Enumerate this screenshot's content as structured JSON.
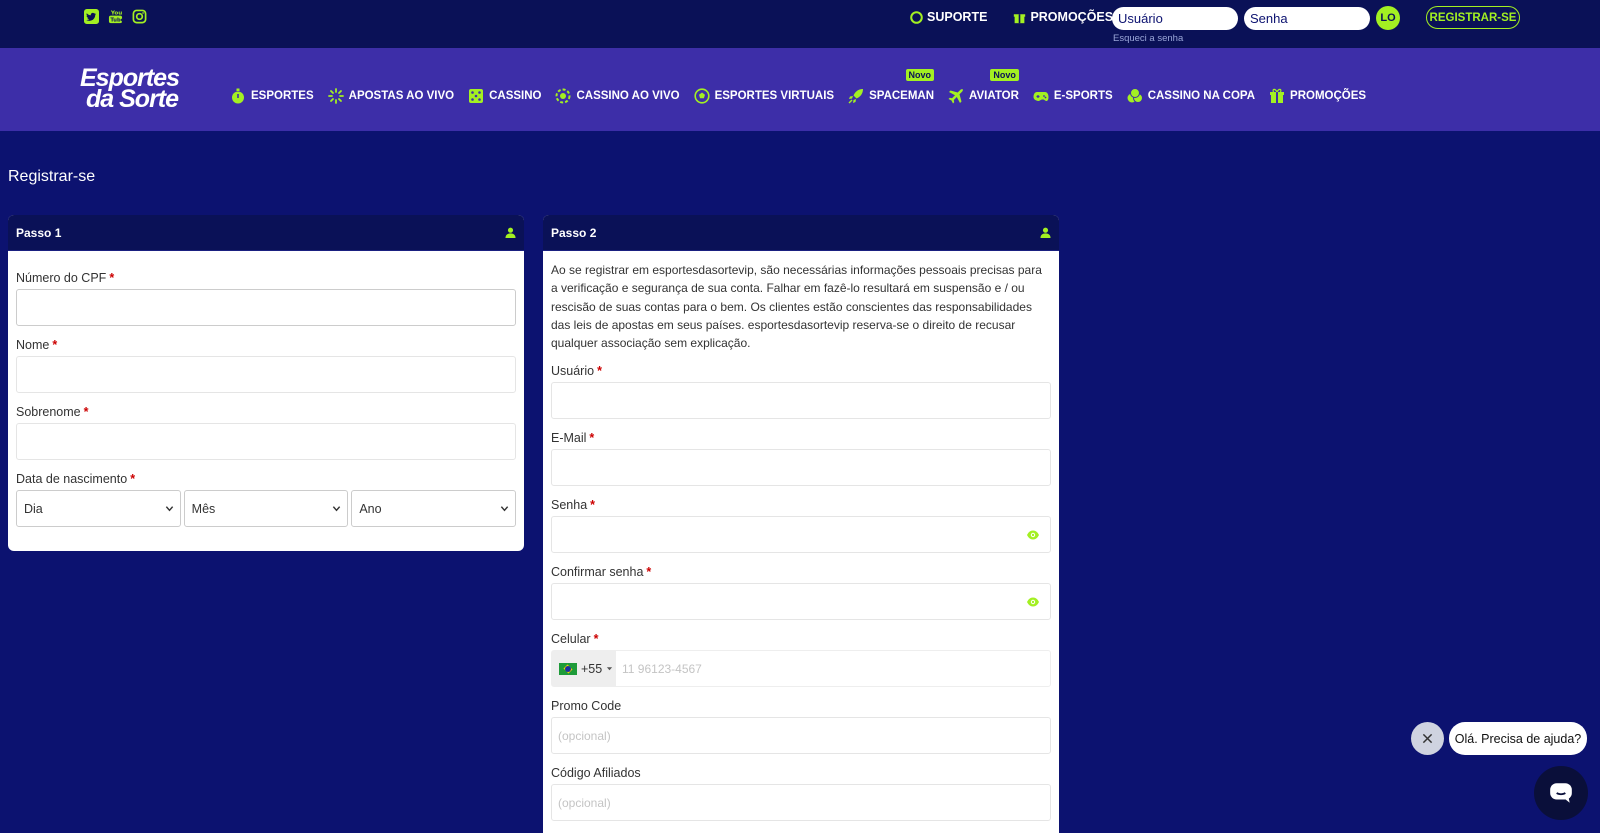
{
  "top_bar": {
    "social_icons": [
      "twitter-icon",
      "youtube-icon",
      "instagram-icon"
    ],
    "support_label": "SUPORTE",
    "promotions_label": "PROMOÇÕES",
    "username_placeholder": "Usuário",
    "password_placeholder": "Senha",
    "login_label": "LO",
    "forgot_password": "Esqueci a senha",
    "register_label": "REGISTRAR-SE"
  },
  "brand": {
    "line1": "Esportes",
    "line2": "da Sorte"
  },
  "nav": {
    "items": [
      {
        "label": "ESPORTES",
        "icon": "stopwatch-icon"
      },
      {
        "label": "APOSTAS AO VIVO",
        "icon": "live-icon"
      },
      {
        "label": "CASSINO",
        "icon": "dice-icon"
      },
      {
        "label": "CASSINO AO VIVO",
        "icon": "chip-icon"
      },
      {
        "label": "ESPORTES VIRTUAIS",
        "icon": "soccer-ball-icon"
      },
      {
        "label": "SPACEMAN",
        "icon": "rocket-icon",
        "badge": "Novo"
      },
      {
        "label": "AVIATOR",
        "icon": "plane-icon",
        "badge": "Novo"
      },
      {
        "label": "E-SPORTS",
        "icon": "gamepad-icon"
      },
      {
        "label": "CASSINO NA COPA",
        "icon": "coins-icon"
      },
      {
        "label": "PROMOÇÕES",
        "icon": "gift-icon"
      }
    ]
  },
  "page_title": "Registrar-se",
  "step1": {
    "title": "Passo 1",
    "cpf_label": "Número do CPF",
    "first_name_label": "Nome",
    "last_name_label": "Sobrenome",
    "birth_label": "Data de nascimento",
    "day": "Dia",
    "month": "Mês",
    "year": "Ano"
  },
  "step2": {
    "title": "Passo 2",
    "intro": "Ao se registrar em esportesdasortevip, são necessárias informações pessoais precisas para a verificação e segurança de sua conta. Falhar em fazê-lo resultará em suspensão e / ou rescisão de suas contas para o bem. Os clientes estão conscientes das responsabilidades das leis de apostas em seus países. esportesdasortevip reserva-se o direito de recusar qualquer associação sem explicação.",
    "username_label": "Usuário",
    "email_label": "E-Mail",
    "password_label": "Senha",
    "confirm_password_label": "Confirmar senha",
    "phone_label": "Celular",
    "country_code": "+55",
    "phone_placeholder": "11 96123-4567",
    "promo_label": "Promo Code",
    "promo_placeholder": "(opcional)",
    "affiliate_label": "Código Afiliados",
    "affiliate_placeholder": "(opcional)",
    "required_mark": "*"
  },
  "chat": {
    "message": "Olá. Precisa de ajuda?"
  },
  "colors": {
    "accent": "#a3f022",
    "background": "#0c1270",
    "nav": "#3d2ea8",
    "topbar": "#0a1157"
  }
}
